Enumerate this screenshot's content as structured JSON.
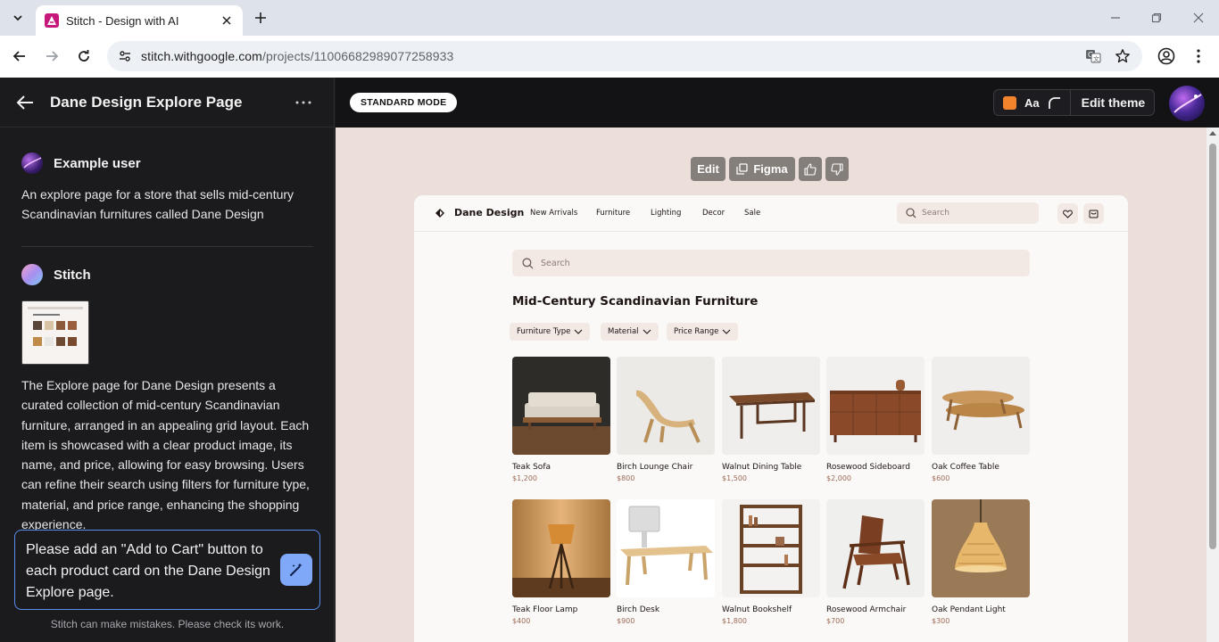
{
  "browser": {
    "tab_title": "Stitch - Design with AI",
    "url_host": "stitch.withgoogle.com",
    "url_path": "/projects/11006682989077258933"
  },
  "project": {
    "title": "Dane Design Explore Page"
  },
  "chat": {
    "user_name": "Example user",
    "user_message": "An explore page for a store that sells mid-century Scandinavian furnitures called Dane Design",
    "bot_name": "Stitch",
    "bot_message": "The Explore page for Dane Design presents a curated collection of mid-century Scandinavian furniture, arranged in an appealing grid layout. Each item is showcased with a clear product image, its name, and price, allowing for easy browsing. Users can refine their search using filters for furniture type, material, and price range, enhancing the shopping experience.",
    "prompt_value": "Please add an \"Add to Cart\" button to each product card on the Dane Design Explore page.",
    "disclaimer": "Stitch can make mistakes. Please check its work."
  },
  "header": {
    "mode_label": "STANDARD MODE",
    "theme_font_label": "Aa",
    "edit_theme_label": "Edit theme",
    "theme_color": "#f2842e"
  },
  "canvas_tools": {
    "edit_label": "Edit",
    "figma_label": "Figma"
  },
  "design": {
    "brand": "Dane Design",
    "nav": [
      "New Arrivals",
      "Furniture",
      "Lighting",
      "Decor",
      "Sale"
    ],
    "top_search_placeholder": "Search",
    "main_search_placeholder": "Search",
    "heading": "Mid-Century Scandinavian Furniture",
    "filters": [
      "Furniture Type",
      "Material",
      "Price Range"
    ],
    "products": [
      {
        "name": "Teak Sofa",
        "price": "$1,200"
      },
      {
        "name": "Birch Lounge Chair",
        "price": "$800"
      },
      {
        "name": "Walnut Dining Table",
        "price": "$1,500"
      },
      {
        "name": "Rosewood Sideboard",
        "price": "$2,000"
      },
      {
        "name": "Oak Coffee Table",
        "price": "$600"
      },
      {
        "name": "Teak Floor Lamp",
        "price": "$400"
      },
      {
        "name": "Birch Desk",
        "price": "$900"
      },
      {
        "name": "Walnut Bookshelf",
        "price": "$1,800"
      },
      {
        "name": "Rosewood Armchair",
        "price": "$700"
      },
      {
        "name": "Oak Pendant Light",
        "price": "$300"
      }
    ]
  }
}
